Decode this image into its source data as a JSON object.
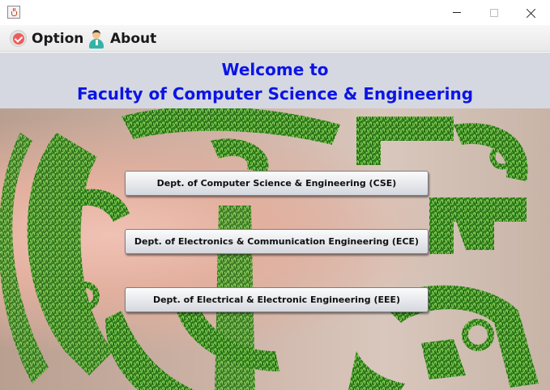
{
  "window": {
    "icon": "java-cup-icon",
    "controls": {
      "minimize": "minimize-icon",
      "maximize": "maximize-icon",
      "close": "close-icon"
    }
  },
  "menubar": {
    "option": {
      "label": "Option",
      "icon": "check-circle-icon"
    },
    "about": {
      "label": "About",
      "icon": "person-icon"
    }
  },
  "header": {
    "welcome": "Welcome to",
    "faculty": "Faculty of Computer Science & Engineering",
    "color": "#0b14e6"
  },
  "departments": [
    {
      "label": "Dept. of Computer Science & Engineering (CSE)"
    },
    {
      "label": "Dept. of Electronics & Communication Engineering (ECE)"
    },
    {
      "label": "Dept. of Electrical & Electronic Engineering (EEE)"
    }
  ],
  "colors": {
    "header_bg": "#d5d8e0",
    "grass": "#2f8a1e"
  }
}
